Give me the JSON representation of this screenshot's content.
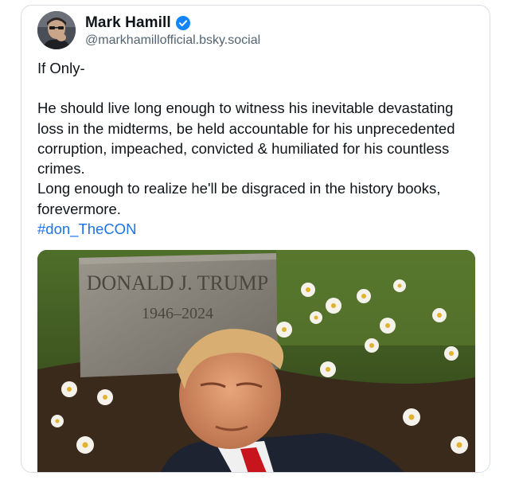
{
  "author": {
    "display_name": "Mark Hamill",
    "handle": "@markhamillofficial.bsky.social",
    "avatar_icon": "avatar-photo",
    "verified_icon": "verified-badge-icon",
    "verified_color": "#1185fe"
  },
  "post": {
    "intro": "If Only-",
    "paragraph": "He should live long enough to witness his inevitable devastating loss in the midterms, be held accountable for his unprecedented corruption, impeached, convicted & humiliated for his countless crimes.\nLong enough to realize he'll be disgraced in the history books, forevermore.",
    "hashtag": "#don_TheCON",
    "hashtag_color": "#1d73e8"
  },
  "media": {
    "headstone_name": "DONALD J. TRUMP",
    "headstone_dates": "1946–2024"
  }
}
